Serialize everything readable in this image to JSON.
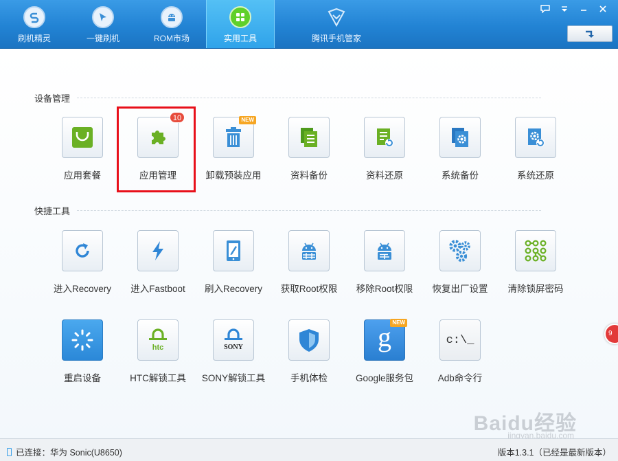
{
  "nav": {
    "tabs": [
      {
        "label": "刷机精灵"
      },
      {
        "label": "一键刷机"
      },
      {
        "label": "ROM市场"
      },
      {
        "label": "实用工具"
      },
      {
        "label": "腾讯手机管家"
      }
    ],
    "active_tab": "实用工具"
  },
  "colors": {
    "accent_blue": "#2283d4",
    "green": "#6ab024",
    "highlight_red": "#e8101a",
    "badge_red": "#e74c3c"
  },
  "sections": [
    {
      "title": "设备管理",
      "items": [
        {
          "label": "应用套餐",
          "icon": "shopping-bag-icon"
        },
        {
          "label": "应用管理",
          "icon": "puzzle-icon",
          "badge": "10"
        },
        {
          "label": "卸载预装应用",
          "icon": "trash-icon",
          "badge": "NEW"
        },
        {
          "label": "资料备份",
          "icon": "document-copy-icon"
        },
        {
          "label": "资料还原",
          "icon": "document-restore-icon"
        },
        {
          "label": "系统备份",
          "icon": "gear-copy-icon"
        },
        {
          "label": "系统还原",
          "icon": "gear-restore-icon"
        }
      ]
    },
    {
      "title": "快捷工具",
      "items": [
        {
          "label": "进入Recovery",
          "icon": "refresh-icon"
        },
        {
          "label": "进入Fastboot",
          "icon": "lightning-icon"
        },
        {
          "label": "刷入Recovery",
          "icon": "tablet-edit-icon"
        },
        {
          "label": "获取Root权限",
          "icon": "android-grid-icon"
        },
        {
          "label": "移除Root权限",
          "icon": "android-remove-icon"
        },
        {
          "label": "恢复出厂设置",
          "icon": "gears-icon"
        },
        {
          "label": "清除锁屏密码",
          "icon": "pattern-lock-icon"
        },
        {
          "label": "重启设备",
          "icon": "spinner-icon"
        },
        {
          "label": "HTC解锁工具",
          "icon": "htc-lock-icon",
          "brand": "htc"
        },
        {
          "label": "SONY解锁工具",
          "icon": "sony-lock-icon",
          "brand": "SONY"
        },
        {
          "label": "手机体检",
          "icon": "shield-icon"
        },
        {
          "label": "Google服务包",
          "icon": "google-icon",
          "badge": "NEW",
          "glyph": "g"
        },
        {
          "label": "Adb命令行",
          "icon": "terminal-icon",
          "glyph": "c:\\_"
        }
      ]
    }
  ],
  "side_bubble": "9",
  "watermark": {
    "text": "Baidu经验",
    "sub": "jingyan.baidu.com"
  },
  "status": {
    "connection": "已连接：华为 Sonic(U8650)",
    "version": "版本1.3.1（已经是最新版本）"
  }
}
